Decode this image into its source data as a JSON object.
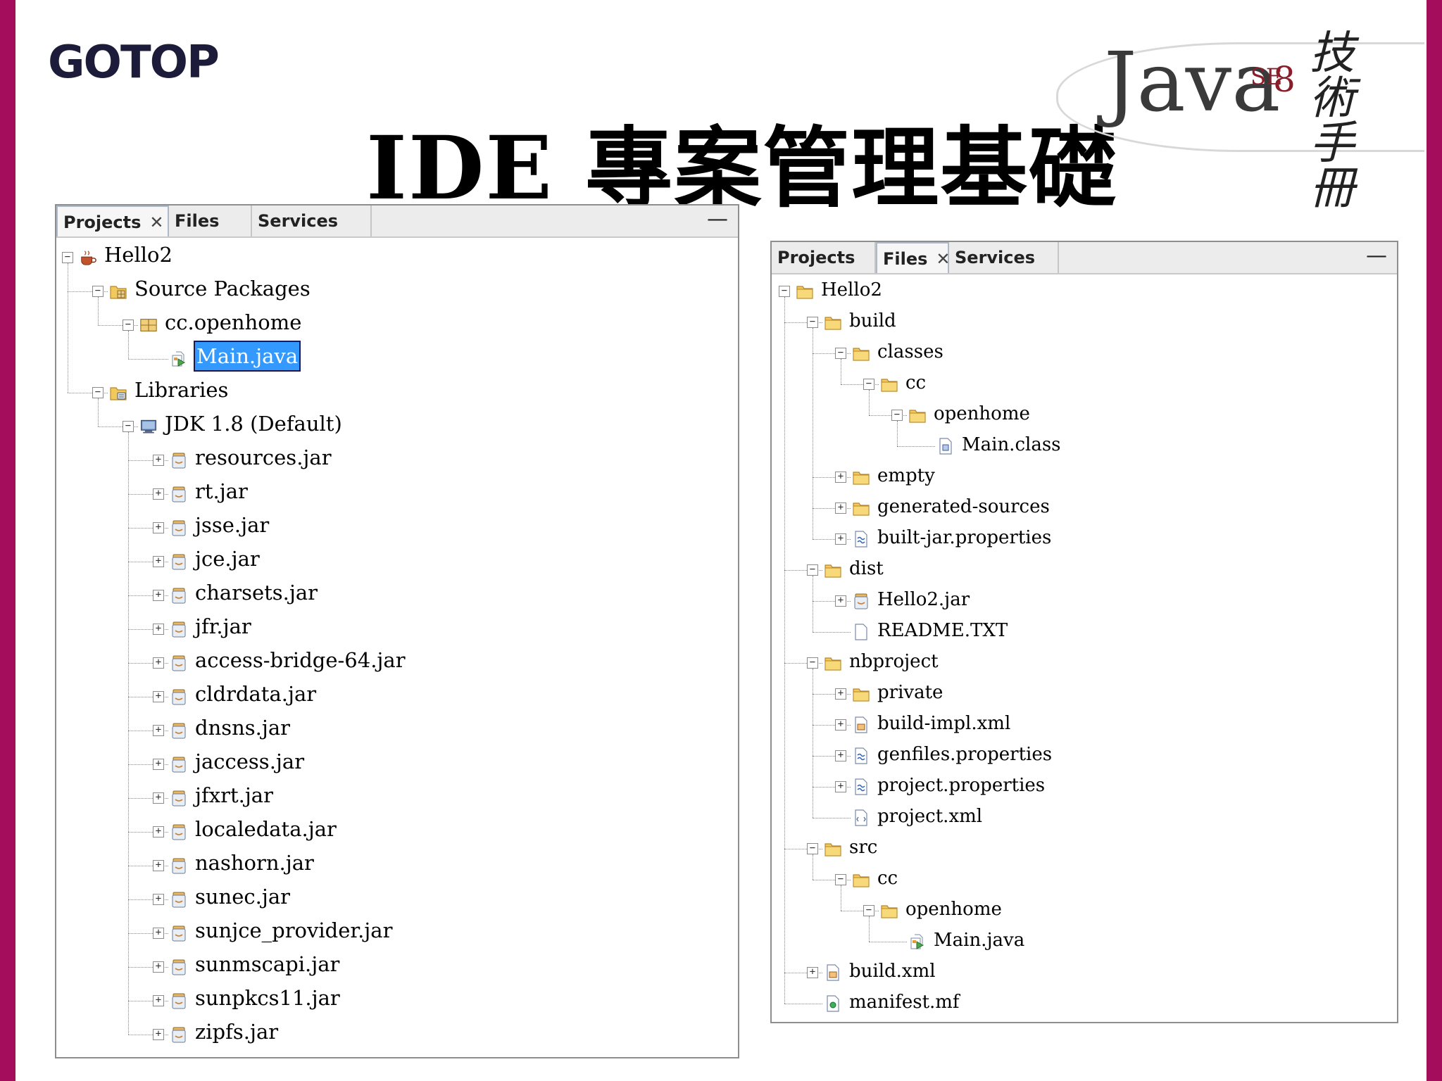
{
  "header": {
    "logo": "GOTOP",
    "title": "IDE 專案管理基礎",
    "brand_java": "Java",
    "brand_se": "SE",
    "brand_version": "8",
    "brand_calligraphy": "技術手冊"
  },
  "left_panel": {
    "tabs": [
      {
        "label": "Projects",
        "active": true,
        "closable": true
      },
      {
        "label": "Files",
        "active": false,
        "closable": false
      },
      {
        "label": "Services",
        "active": false,
        "closable": false
      }
    ],
    "minimize_label": "—",
    "tree": [
      {
        "label": "Hello2",
        "depth": 0,
        "toggle": "minus",
        "icon": "coffee-cup-icon"
      },
      {
        "label": "Source Packages",
        "depth": 1,
        "toggle": "minus",
        "icon": "source-folder-icon"
      },
      {
        "label": "cc.openhome",
        "depth": 2,
        "toggle": "minus",
        "icon": "package-icon"
      },
      {
        "label": "Main.java",
        "depth": 3,
        "toggle": "none",
        "icon": "java-file-icon",
        "selected": true
      },
      {
        "label": "Libraries",
        "depth": 1,
        "toggle": "minus",
        "icon": "library-folder-icon"
      },
      {
        "label": "JDK 1.8 (Default)",
        "depth": 2,
        "toggle": "minus",
        "icon": "jdk-monitor-icon"
      },
      {
        "label": "resources.jar",
        "depth": 3,
        "toggle": "plus",
        "icon": "jar-icon"
      },
      {
        "label": "rt.jar",
        "depth": 3,
        "toggle": "plus",
        "icon": "jar-icon"
      },
      {
        "label": "jsse.jar",
        "depth": 3,
        "toggle": "plus",
        "icon": "jar-icon"
      },
      {
        "label": "jce.jar",
        "depth": 3,
        "toggle": "plus",
        "icon": "jar-icon"
      },
      {
        "label": "charsets.jar",
        "depth": 3,
        "toggle": "plus",
        "icon": "jar-icon"
      },
      {
        "label": "jfr.jar",
        "depth": 3,
        "toggle": "plus",
        "icon": "jar-icon"
      },
      {
        "label": "access-bridge-64.jar",
        "depth": 3,
        "toggle": "plus",
        "icon": "jar-icon"
      },
      {
        "label": "cldrdata.jar",
        "depth": 3,
        "toggle": "plus",
        "icon": "jar-icon"
      },
      {
        "label": "dnsns.jar",
        "depth": 3,
        "toggle": "plus",
        "icon": "jar-icon"
      },
      {
        "label": "jaccess.jar",
        "depth": 3,
        "toggle": "plus",
        "icon": "jar-icon"
      },
      {
        "label": "jfxrt.jar",
        "depth": 3,
        "toggle": "plus",
        "icon": "jar-icon"
      },
      {
        "label": "localedata.jar",
        "depth": 3,
        "toggle": "plus",
        "icon": "jar-icon"
      },
      {
        "label": "nashorn.jar",
        "depth": 3,
        "toggle": "plus",
        "icon": "jar-icon"
      },
      {
        "label": "sunec.jar",
        "depth": 3,
        "toggle": "plus",
        "icon": "jar-icon"
      },
      {
        "label": "sunjce_provider.jar",
        "depth": 3,
        "toggle": "plus",
        "icon": "jar-icon"
      },
      {
        "label": "sunmscapi.jar",
        "depth": 3,
        "toggle": "plus",
        "icon": "jar-icon"
      },
      {
        "label": "sunpkcs11.jar",
        "depth": 3,
        "toggle": "plus",
        "icon": "jar-icon"
      },
      {
        "label": "zipfs.jar",
        "depth": 3,
        "toggle": "plus",
        "icon": "jar-icon"
      }
    ]
  },
  "right_panel": {
    "tabs": [
      {
        "label": "Projects",
        "active": false,
        "closable": false
      },
      {
        "label": "Files",
        "active": true,
        "closable": true
      },
      {
        "label": "Services",
        "active": false,
        "closable": false
      }
    ],
    "minimize_label": "—",
    "tree": [
      {
        "label": "Hello2",
        "depth": 0,
        "toggle": "minus",
        "icon": "folder-icon"
      },
      {
        "label": "build",
        "depth": 1,
        "toggle": "minus",
        "icon": "folder-icon"
      },
      {
        "label": "classes",
        "depth": 2,
        "toggle": "minus",
        "icon": "folder-icon"
      },
      {
        "label": "cc",
        "depth": 3,
        "toggle": "minus",
        "icon": "folder-icon"
      },
      {
        "label": "openhome",
        "depth": 4,
        "toggle": "minus",
        "icon": "folder-icon"
      },
      {
        "label": "Main.class",
        "depth": 5,
        "toggle": "none",
        "icon": "class-file-icon"
      },
      {
        "label": "empty",
        "depth": 2,
        "toggle": "plus",
        "icon": "folder-icon"
      },
      {
        "label": "generated-sources",
        "depth": 2,
        "toggle": "plus",
        "icon": "folder-icon"
      },
      {
        "label": "built-jar.properties",
        "depth": 2,
        "toggle": "plus",
        "icon": "properties-file-icon"
      },
      {
        "label": "dist",
        "depth": 1,
        "toggle": "minus",
        "icon": "folder-icon"
      },
      {
        "label": "Hello2.jar",
        "depth": 2,
        "toggle": "plus",
        "icon": "jar-icon"
      },
      {
        "label": "README.TXT",
        "depth": 2,
        "toggle": "none",
        "icon": "text-file-icon"
      },
      {
        "label": "nbproject",
        "depth": 1,
        "toggle": "minus",
        "icon": "folder-icon"
      },
      {
        "label": "private",
        "depth": 2,
        "toggle": "plus",
        "icon": "folder-icon"
      },
      {
        "label": "build-impl.xml",
        "depth": 2,
        "toggle": "plus",
        "icon": "ant-xml-icon"
      },
      {
        "label": "genfiles.properties",
        "depth": 2,
        "toggle": "plus",
        "icon": "properties-file-icon"
      },
      {
        "label": "project.properties",
        "depth": 2,
        "toggle": "plus",
        "icon": "properties-file-icon"
      },
      {
        "label": "project.xml",
        "depth": 2,
        "toggle": "none",
        "icon": "xml-file-icon"
      },
      {
        "label": "src",
        "depth": 1,
        "toggle": "minus",
        "icon": "folder-icon"
      },
      {
        "label": "cc",
        "depth": 2,
        "toggle": "minus",
        "icon": "folder-icon"
      },
      {
        "label": "openhome",
        "depth": 3,
        "toggle": "minus",
        "icon": "folder-icon"
      },
      {
        "label": "Main.java",
        "depth": 4,
        "toggle": "none",
        "icon": "java-file-icon"
      },
      {
        "label": "build.xml",
        "depth": 1,
        "toggle": "plus",
        "icon": "ant-xml-icon"
      },
      {
        "label": "manifest.mf",
        "depth": 1,
        "toggle": "none",
        "icon": "manifest-file-icon"
      }
    ]
  },
  "colors": {
    "frame": "#a30d5b",
    "selection": "#3399ff",
    "folder": "#e8b64a"
  }
}
